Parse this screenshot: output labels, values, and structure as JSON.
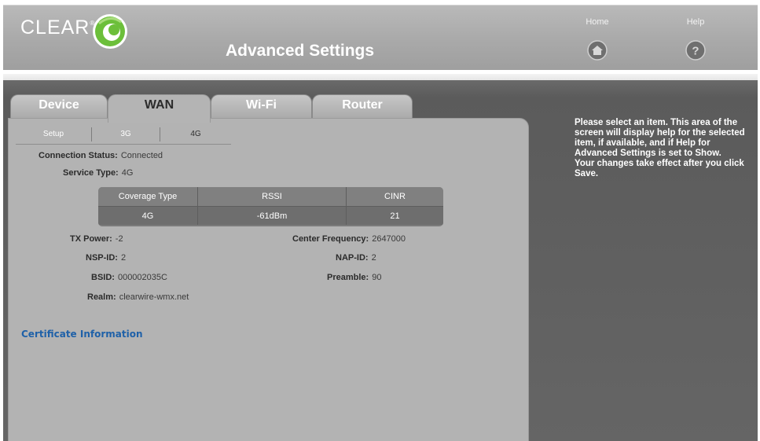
{
  "brand": {
    "name": "CLEAR",
    "trademark": "®"
  },
  "header": {
    "title": "Advanced Settings",
    "nav": [
      {
        "label": "Home",
        "icon": "home-icon"
      },
      {
        "label": "Help",
        "icon": "help-icon"
      }
    ]
  },
  "tabs": [
    {
      "label": "Device",
      "active": false
    },
    {
      "label": "WAN",
      "active": true
    },
    {
      "label": "Wi-Fi",
      "active": false
    },
    {
      "label": "Router",
      "active": false
    }
  ],
  "subtabs": [
    {
      "label": "Setup",
      "active": false
    },
    {
      "label": "3G",
      "active": false
    },
    {
      "label": "4G",
      "active": true
    }
  ],
  "status": {
    "connection_label": "Connection Status:",
    "connection_value": "Connected",
    "service_label": "Service Type:",
    "service_value": "4G"
  },
  "signal_table": {
    "headers": [
      "Coverage Type",
      "RSSI",
      "CINR"
    ],
    "row": [
      "4G",
      "-61dBm",
      "21"
    ]
  },
  "details": {
    "left": [
      {
        "label": "TX Power:",
        "value": "-2"
      },
      {
        "label": "NSP-ID:",
        "value": "2"
      },
      {
        "label": "BSID:",
        "value": "000002035C"
      },
      {
        "label": "Realm:",
        "value": "clearwire-wmx.net"
      }
    ],
    "right": [
      {
        "label": "Center Frequency:",
        "value": "2647000"
      },
      {
        "label": "NAP-ID:",
        "value": "2"
      },
      {
        "label": "Preamble:",
        "value": "90"
      }
    ]
  },
  "certificate_link": "Certificate Information",
  "help_text": {
    "line1": "Please select an item. This area of the screen will display help for the selected item, if available, and if Help for Advanced Settings is set to Show.",
    "line2": "Your changes take effect after you click Save."
  },
  "colors": {
    "header_gray": "#a9a9a9",
    "panel_gray": "#b3b3b3",
    "link_blue": "#1f61a8",
    "logo_green": "#6cbf3a"
  }
}
